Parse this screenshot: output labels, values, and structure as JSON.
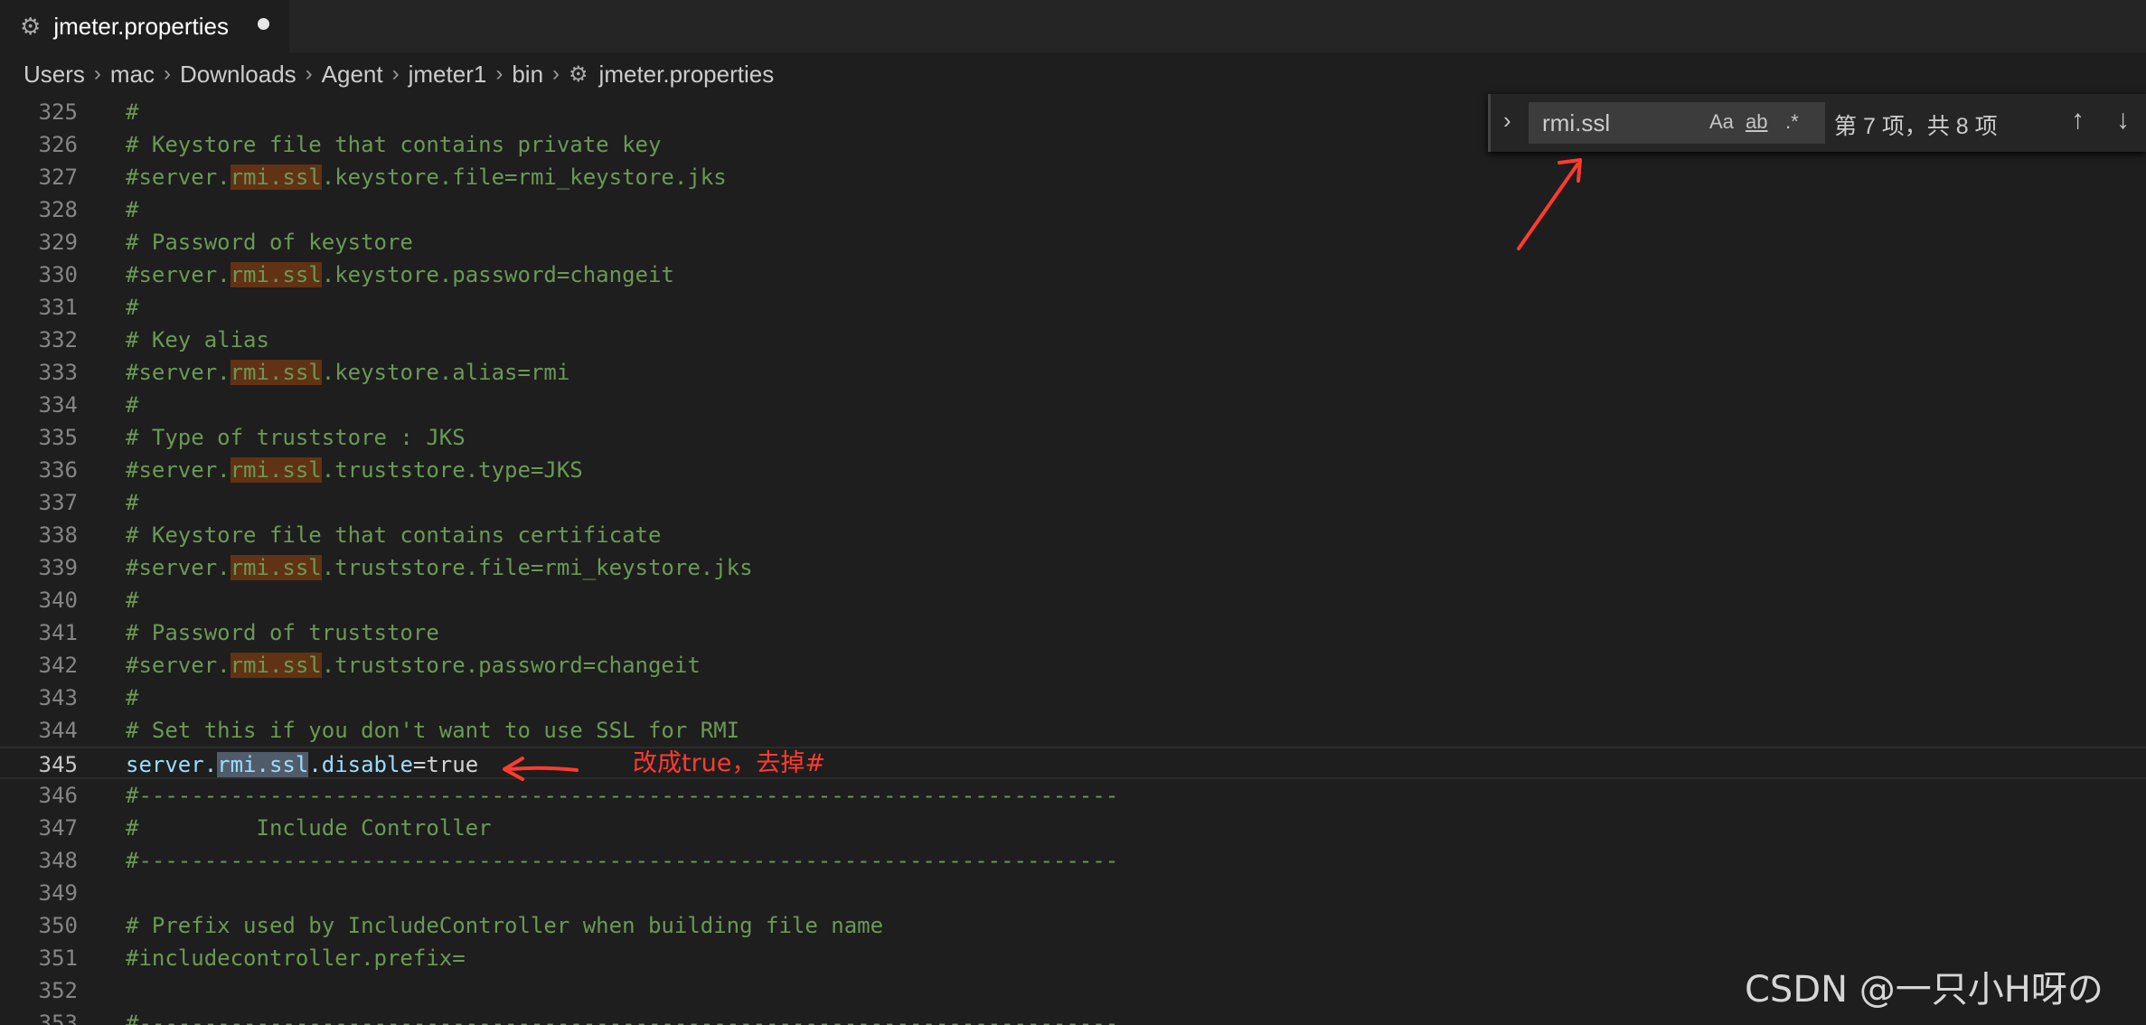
{
  "tab": {
    "icon": "gear-icon",
    "title": "jmeter.properties",
    "modified": true
  },
  "breadcrumb": {
    "items": [
      "Users",
      "mac",
      "Downloads",
      "Agent",
      "jmeter1",
      "bin"
    ],
    "file_icon": "gear-icon",
    "file": "jmeter.properties"
  },
  "find": {
    "query": "rmi.ssl",
    "match_case": "Aa",
    "whole_word": "ab",
    "regex": ".*",
    "count": "第 7 项，共 8 项",
    "prev_icon": "arrow-up-icon",
    "next_icon": "arrow-down-icon"
  },
  "editor": {
    "lines": [
      {
        "n": "325",
        "pre": "#"
      },
      {
        "n": "326",
        "pre": "# Keystore file that contains private key"
      },
      {
        "n": "327",
        "pre": "#server.",
        "match": "rmi.ssl",
        "post": ".keystore.file=rmi_keystore.jks"
      },
      {
        "n": "328",
        "pre": "#"
      },
      {
        "n": "329",
        "pre": "# Password of keystore"
      },
      {
        "n": "330",
        "pre": "#server.",
        "match": "rmi.ssl",
        "post": ".keystore.password=changeit"
      },
      {
        "n": "331",
        "pre": "#"
      },
      {
        "n": "332",
        "pre": "# Key alias"
      },
      {
        "n": "333",
        "pre": "#server.",
        "match": "rmi.ssl",
        "post": ".keystore.alias=rmi"
      },
      {
        "n": "334",
        "pre": "#"
      },
      {
        "n": "335",
        "pre": "# Type of truststore : JKS"
      },
      {
        "n": "336",
        "pre": "#server.",
        "match": "rmi.ssl",
        "post": ".truststore.type=JKS"
      },
      {
        "n": "337",
        "pre": "#"
      },
      {
        "n": "338",
        "pre": "# Keystore file that contains certificate"
      },
      {
        "n": "339",
        "pre": "#server.",
        "match": "rmi.ssl",
        "post": ".truststore.file=rmi_keystore.jks"
      },
      {
        "n": "340",
        "pre": "#"
      },
      {
        "n": "341",
        "pre": "# Password of truststore"
      },
      {
        "n": "342",
        "pre": "#server.",
        "match": "rmi.ssl",
        "post": ".truststore.password=changeit"
      },
      {
        "n": "343",
        "pre": "#"
      },
      {
        "n": "344",
        "pre": "# Set this if you don't want to use SSL for RMI"
      },
      {
        "n": "345",
        "pre": "server.",
        "match": "rmi.ssl",
        "post": ".disable",
        "tail": "=true",
        "current": true
      },
      {
        "n": "346",
        "pre": "#---------------------------------------------------------------------------"
      },
      {
        "n": "347",
        "pre": "#         Include Controller"
      },
      {
        "n": "348",
        "pre": "#---------------------------------------------------------------------------"
      },
      {
        "n": "349",
        "pre": ""
      },
      {
        "n": "350",
        "pre": "# Prefix used by IncludeController when building file name"
      },
      {
        "n": "351",
        "pre": "#includecontroller.prefix="
      },
      {
        "n": "352",
        "pre": ""
      },
      {
        "n": "353",
        "pre": "#---------------------------------------------------------------------------"
      }
    ]
  },
  "annotation": {
    "text": "改成true，去掉#",
    "color": "#ff3b30"
  },
  "watermark": "CSDN @一只小H呀の",
  "colors": {
    "comment": "#6a9955",
    "match": "#613214",
    "current_match": "#515c6a",
    "property": "#9cdcfe"
  }
}
